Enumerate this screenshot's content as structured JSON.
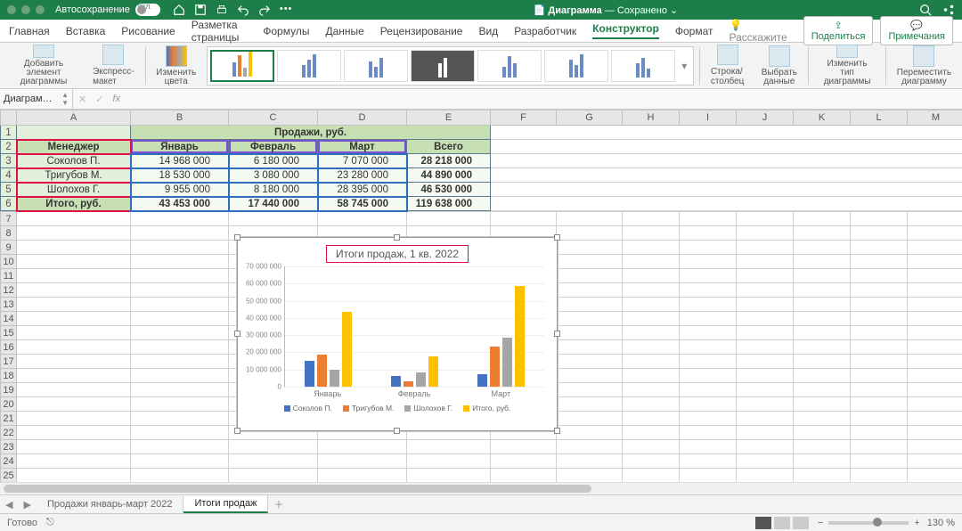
{
  "titlebar": {
    "autosave_label": "Автосохранение",
    "autosave_switch": "ВКЛ.",
    "doc_icon": "W",
    "doc_name": "Диаграмма",
    "doc_status": "— Сохранено",
    "chevron": "⌄"
  },
  "tabs": {
    "items": [
      "Главная",
      "Вставка",
      "Рисование",
      "Разметка страницы",
      "Формулы",
      "Данные",
      "Рецензирование",
      "Вид",
      "Разработчик",
      "Конструктор",
      "Формат"
    ],
    "active_index": 9,
    "tellme": "Расскажите",
    "share": "Поделиться",
    "comments": "Примечания"
  },
  "ribbon": {
    "g1": "Добавить элемент диаграммы",
    "g2": "Экспресс-макет",
    "g3": "Изменить цвета",
    "g4": "Строка/столбец",
    "g5": "Выбрать данные",
    "g6": "Изменить тип диаграммы",
    "g7": "Переместить диаграмму"
  },
  "namebox": {
    "value": "Диаграм…",
    "fx": "fx"
  },
  "columns": [
    "",
    "A",
    "B",
    "C",
    "D",
    "E",
    "F",
    "G",
    "H",
    "I",
    "J",
    "K",
    "L",
    "M"
  ],
  "table": {
    "title": "Продажи, руб.",
    "header": [
      "Менеджер",
      "Январь",
      "Февраль",
      "Март",
      "Всего"
    ],
    "rows": [
      [
        "Соколов П.",
        "14 968 000",
        "6 180 000",
        "7 070 000",
        "28 218 000"
      ],
      [
        "Тригубов М.",
        "18 530 000",
        "3 080 000",
        "23 280 000",
        "44 890 000"
      ],
      [
        "Шолохов Г.",
        "9 955 000",
        "8 180 000",
        "28 395 000",
        "46 530 000"
      ],
      [
        "Итого, руб.",
        "43 453 000",
        "17 440 000",
        "58 745 000",
        "119 638 000"
      ]
    ]
  },
  "chart_data": {
    "type": "bar",
    "title": "Итоги продаж, 1 кв. 2022",
    "categories": [
      "Январь",
      "Февраль",
      "Март"
    ],
    "series": [
      {
        "name": "Соколов П.",
        "values": [
          14968000,
          6180000,
          7070000
        ],
        "color": "#4472c4"
      },
      {
        "name": "Тригубов М.",
        "values": [
          18530000,
          3080000,
          23280000
        ],
        "color": "#ed7d31"
      },
      {
        "name": "Шолохов Г.",
        "values": [
          9955000,
          8180000,
          28395000
        ],
        "color": "#a5a5a5"
      },
      {
        "name": "Итого, руб.",
        "values": [
          43453000,
          17440000,
          58745000
        ],
        "color": "#ffc000"
      }
    ],
    "ylim": [
      0,
      70000000
    ],
    "yticks": [
      "0",
      "10 000 000",
      "20 000 000",
      "30 000 000",
      "40 000 000",
      "50 000 000",
      "60 000 000",
      "70 000 000"
    ]
  },
  "sheets": {
    "items": [
      "Продажи январь-март 2022",
      "Итоги продаж"
    ],
    "active_index": 1
  },
  "status": {
    "ready": "Готово",
    "zoom": "130 %"
  }
}
